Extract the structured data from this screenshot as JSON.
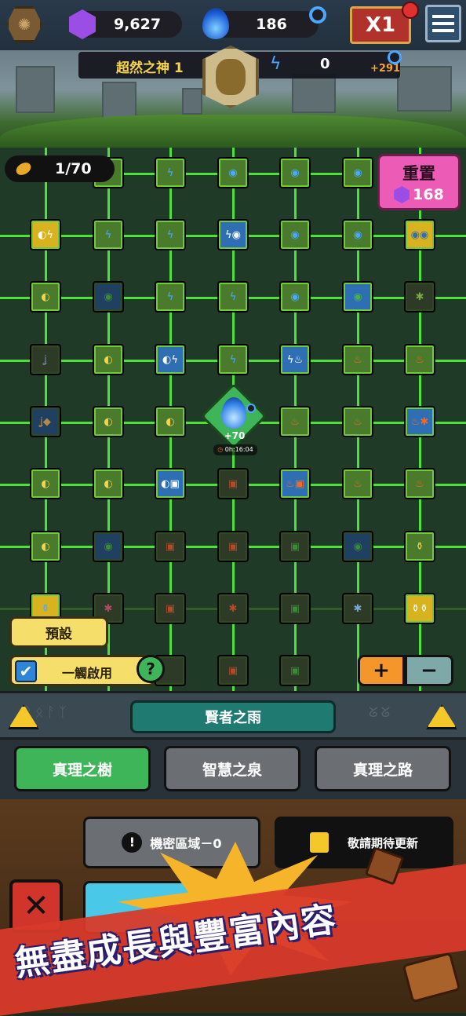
{
  "topbar": {
    "gems": "9,627",
    "blue_fire": "186",
    "speed": "X1"
  },
  "god": {
    "name": "超然之神 1",
    "energy": "0",
    "energy_bonus": "+291"
  },
  "board": {
    "seeds": "1/70",
    "reset_label": "重置",
    "reset_cost": "168",
    "center_bonus": "+70",
    "center_timer": "0h:16:04",
    "preset_label": "預設",
    "one_touch_label": "一觸啟用",
    "help": "?",
    "plus": "+",
    "minus": "−"
  },
  "section": {
    "title": "賢者之雨"
  },
  "tabs": [
    {
      "label": "真理之樹"
    },
    {
      "label": "智慧之泉"
    },
    {
      "label": "真理之路"
    }
  ],
  "lower": {
    "secret_area": "機密區域－0",
    "coming_soon": "敬請期待更新",
    "promo": "無盡成長與豐富內容"
  },
  "colors": {
    "accent_green": "#4fe03a",
    "gem_purple": "#9b4ee6",
    "reset_pink": "#ec5cb6"
  }
}
